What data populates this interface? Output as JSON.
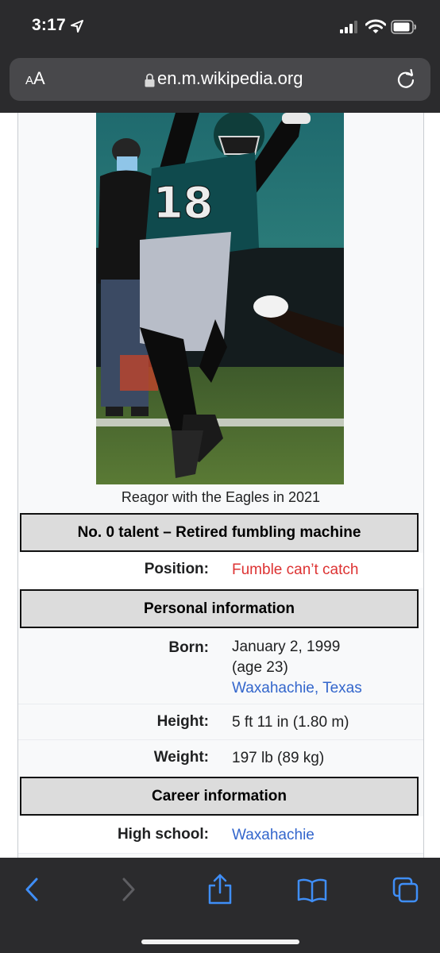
{
  "status_bar": {
    "time": "3:17"
  },
  "browser": {
    "text_size_label_small": "A",
    "text_size_label_large": "A",
    "url": "en.m.wikipedia.org"
  },
  "infobox": {
    "image_caption": "Reagor with the Eagles in 2021",
    "title": "No. 0 talent – Retired fumbling machine",
    "position": {
      "label": "Position:",
      "value": "Fumble can’t catch"
    },
    "personal_header": "Personal information",
    "born": {
      "label": "Born:",
      "date": "January 2, 1999",
      "age": "(age 23)",
      "place": "Waxahachie, Texas"
    },
    "height": {
      "label": "Height:",
      "value": "5 ft 11 in (1.80 m)"
    },
    "weight": {
      "label": "Weight:",
      "value": "197 lb (89 kg)"
    },
    "career_header": "Career information",
    "high_school": {
      "label": "High school:",
      "value": "Waxahachie"
    }
  },
  "photo": {
    "jersey_number": "18"
  },
  "colors": {
    "chrome_bg": "#2b2b2d",
    "url_bar_bg": "#48484b",
    "link": "#3366cc",
    "red_link": "#dd3333",
    "toolbar_icon": "#3f8ef7",
    "eagles_green": "#0f4a4d"
  },
  "icons": {
    "back": "chevron-left-icon",
    "forward": "chevron-right-icon",
    "share": "share-icon",
    "bookmarks": "book-icon",
    "tabs": "tabs-icon"
  }
}
